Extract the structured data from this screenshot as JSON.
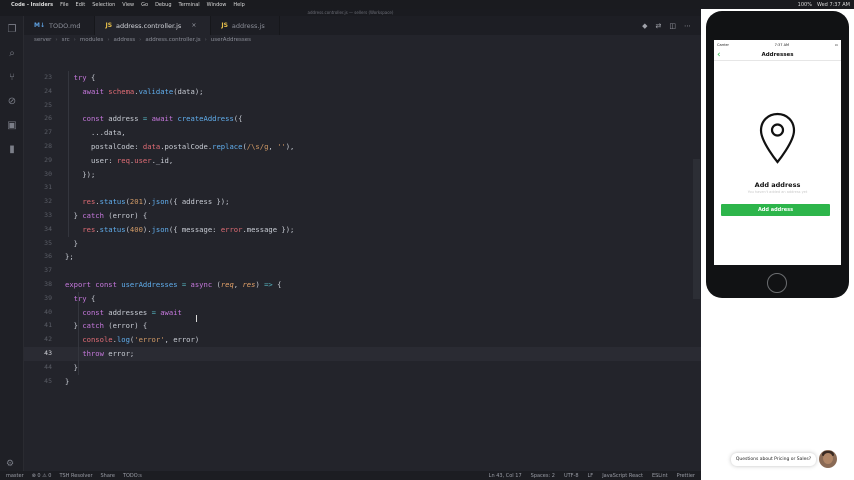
{
  "menubar": {
    "app": "Code - Insiders",
    "items": [
      "File",
      "Edit",
      "Selection",
      "View",
      "Go",
      "Debug",
      "Terminal",
      "Window",
      "Help"
    ],
    "status": [
      "100%",
      "Wed 7:37 AM"
    ]
  },
  "window_title": "address.controller.js — sellers (Workspace)",
  "tabs": [
    {
      "icon": "M↓",
      "label": "TODO.md",
      "active": false
    },
    {
      "icon": "JS",
      "label": "address.controller.js",
      "active": true
    },
    {
      "icon": "JS",
      "label": "address.js",
      "active": false
    }
  ],
  "breadcrumb": [
    "server",
    "src",
    "modules",
    "address",
    "address.controller.js",
    "userAddresses"
  ],
  "code_lines": [
    {
      "n": "23",
      "html": "  <span class='kw'>try</span> <span class='plain'>{</span>"
    },
    {
      "n": "24",
      "html": "    <span class='kw'>await</span> <span class='var'>schema</span>.<span class='fn'>validate</span>(data);"
    },
    {
      "n": "25",
      "html": ""
    },
    {
      "n": "26",
      "html": "    <span class='kw'>const</span> address <span class='op'>=</span> <span class='kw'>await</span> <span class='fn'>createAddress</span>({"
    },
    {
      "n": "27",
      "html": "      ...data,"
    },
    {
      "n": "28",
      "html": "      <span class='plain'>postalCode:</span> <span class='var'>data</span>.postalCode.<span class='fn'>replace</span>(<span class='str'>/\\s/g</span>, <span class='str'>''</span>),"
    },
    {
      "n": "29",
      "html": "      <span class='plain'>user:</span> <span class='var'>req</span>.<span class='var'>user</span>._id,"
    },
    {
      "n": "30",
      "html": "    });"
    },
    {
      "n": "31",
      "html": ""
    },
    {
      "n": "32",
      "html": "    <span class='var'>res</span>.<span class='fn'>status</span>(<span class='num'>201</span>).<span class='fn'>json</span>({ address });"
    },
    {
      "n": "33",
      "html": "  } <span class='kw'>catch</span> (error) {"
    },
    {
      "n": "34",
      "html": "    <span class='var'>res</span>.<span class='fn'>status</span>(<span class='num'>400</span>).<span class='fn'>json</span>({ message: <span class='var'>error</span>.message });"
    },
    {
      "n": "35",
      "html": "  }"
    },
    {
      "n": "36",
      "html": "};"
    },
    {
      "n": "37",
      "html": ""
    },
    {
      "n": "38",
      "html": "<span class='kw'>export</span> <span class='kw'>const</span> <span class='fn'>userAddresses</span> <span class='op'>=</span> <span class='kw'>async</span> (<span class='param'>req</span>, <span class='param'>res</span>) <span class='op'>=&gt;</span> {"
    },
    {
      "n": "39",
      "html": "  <span class='kw'>try</span> {"
    },
    {
      "n": "40",
      "html": "    <span class='kw'>const</span> addresses <span class='op'>=</span> <span class='kw'>await</span>"
    },
    {
      "n": "41",
      "html": "  } <span class='kw'>catch</span> (error) {"
    },
    {
      "n": "42",
      "html": "    <span class='var'>console</span>.<span class='fn'>log</span>(<span class='str'>'error'</span>, error)"
    },
    {
      "n": "43",
      "html": "    <span class='kw'>throw</span> error;"
    },
    {
      "n": "44",
      "html": "  }"
    },
    {
      "n": "45",
      "html": "}"
    }
  ],
  "current_line": "43",
  "statusbar": {
    "left": [
      "master",
      "⊗ 0 ⚠ 0",
      "TSH Resolver",
      "Share",
      "TODO:s"
    ],
    "right": [
      "Ln 43, Col 17",
      "Spaces: 2",
      "UTF-8",
      "LF",
      "JavaScript React",
      "ESLint",
      "Prettier"
    ]
  },
  "phone": {
    "carrier": "Carrier",
    "time": "7:37 AM",
    "nav_title": "Addresses",
    "empty_title": "Add address",
    "empty_subtitle": "You haven't added an address yet",
    "button_label": "Add address",
    "accent": "#2db54b"
  },
  "chat_bubble": "Questions about Pricing or Sales?"
}
